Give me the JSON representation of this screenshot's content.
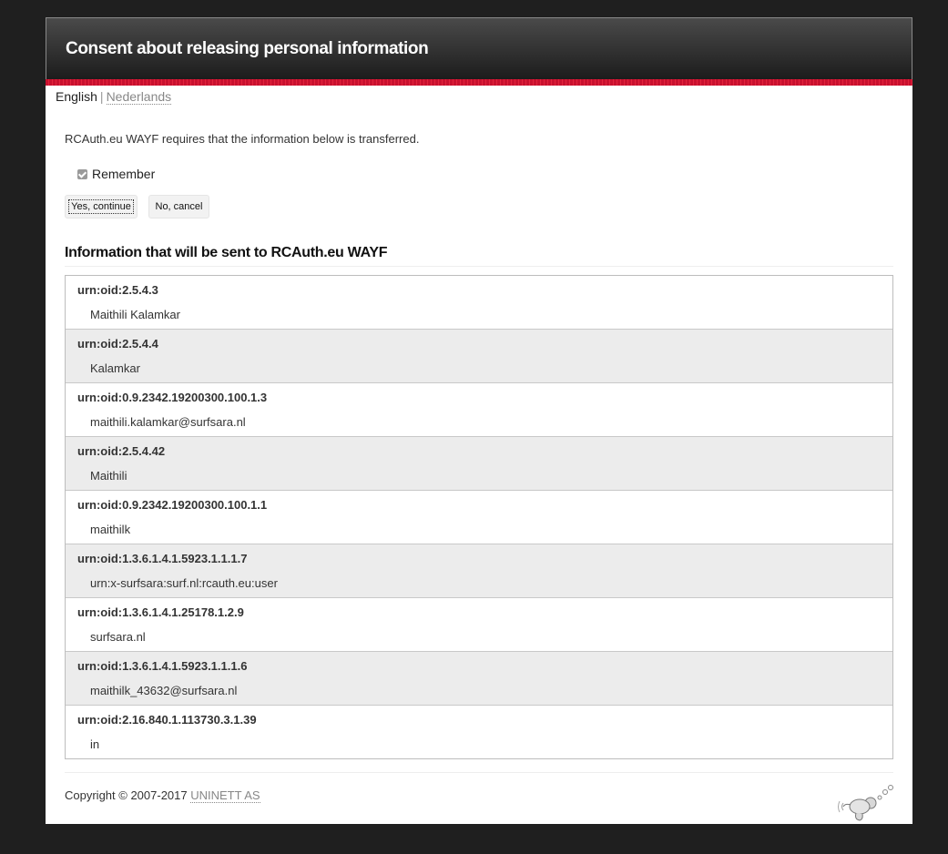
{
  "header": {
    "title": "Consent about releasing personal information"
  },
  "language": {
    "current": "English",
    "separator": "|",
    "other": "Nederlands"
  },
  "intro": "RCAuth.eu WAYF requires that the information below is transferred.",
  "remember": {
    "label": "Remember",
    "checked": true
  },
  "buttons": {
    "yes": "Yes, continue",
    "no": "No, cancel"
  },
  "section_title": "Information that will be sent to RCAuth.eu WAYF",
  "attributes": [
    {
      "name": "urn:oid:2.5.4.3",
      "value": "Maithili Kalamkar"
    },
    {
      "name": "urn:oid:2.5.4.4",
      "value": "Kalamkar"
    },
    {
      "name": "urn:oid:0.9.2342.19200300.100.1.3",
      "value": "maithili.kalamkar@surfsara.nl"
    },
    {
      "name": "urn:oid:2.5.4.42",
      "value": "Maithili"
    },
    {
      "name": "urn:oid:0.9.2342.19200300.100.1.1",
      "value": "maithilk"
    },
    {
      "name": "urn:oid:1.3.6.1.4.1.5923.1.1.1.7",
      "value": "urn:x-surfsara:surf.nl:rcauth.eu:user"
    },
    {
      "name": "urn:oid:1.3.6.1.4.1.25178.1.2.9",
      "value": "surfsara.nl"
    },
    {
      "name": "urn:oid:1.3.6.1.4.1.5923.1.1.1.6",
      "value": "maithilk_43632@surfsara.nl"
    },
    {
      "name": "urn:oid:2.16.840.1.113730.3.1.39",
      "value": "in"
    }
  ],
  "footer": {
    "copyright": "Copyright © 2007-2017",
    "company": "UNINETT AS"
  },
  "icons": {
    "logo": "simplesamlphp-logo-icon",
    "checkbox": "check-icon"
  },
  "colors": {
    "accent_red": "#c8102e",
    "header_dark": "#1c1c1c",
    "row_alt": "#ececec"
  }
}
